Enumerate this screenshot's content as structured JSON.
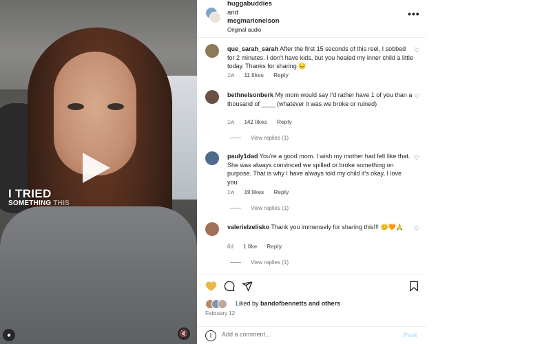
{
  "video": {
    "overlay_line1": "I TRIED",
    "overlay_line2": "SOMETHING",
    "overlay_line2_faded": "THIS",
    "play_icon": "play-icon",
    "profile_icon": "person-icon",
    "mute_icon": "muted-speaker-icon"
  },
  "header": {
    "user1": "huggabuddies",
    "joiner": "and",
    "user2": "megmarienelson",
    "audio": "Original audio",
    "more_label": "•••"
  },
  "comments": [
    {
      "user": "que_sarah_sarah",
      "text": "After the first 15 seconds of this reel, I sobbed for 2 minutes. I don't have kids, but you healed my inner child a little today. Thanks for sharing 😔",
      "time": "1w",
      "likes": "11 likes",
      "reply": "Reply",
      "avatar_color": "#8c7a5a"
    },
    {
      "user": "bethnelsonberk",
      "text": "My mom would say I'd rather have 1 of you than a thousand of ____ (whatever it was we broke or ruined)",
      "time": "1w",
      "likes": "142 likes",
      "reply": "Reply",
      "view_replies": "View replies (1)",
      "avatar_color": "#6b5144"
    },
    {
      "user": "pauly1dad",
      "text": "You're a good mom. I wish my mother had felt like that. She was always convinced we spilled or broke something on purpose. That is why I have always told my child it's okay, I love you.",
      "time": "1w",
      "likes": "19 likes",
      "reply": "Reply",
      "view_replies": "View replies (1)",
      "avatar_color": "#4f6d8a"
    },
    {
      "user": "valerielzelisko",
      "text": "Thank you immensely for sharing this!!! 😊🧡🙏",
      "time": "6d",
      "likes": "1 like",
      "reply": "Reply",
      "view_replies": "View replies (1)",
      "avatar_color": "#a0705a"
    }
  ],
  "actions": {
    "like_icon": "heart-filled-icon",
    "comment_icon": "comment-bubble-icon",
    "share_icon": "paper-plane-icon",
    "save_icon": "bookmark-icon",
    "like_color": "#e8b84a"
  },
  "likes": {
    "prefix": "Liked by",
    "user": "bandofbennetts",
    "suffix": "and others",
    "date": "February 12"
  },
  "add_comment": {
    "placeholder": "Add a comment...",
    "post_label": "Post"
  }
}
